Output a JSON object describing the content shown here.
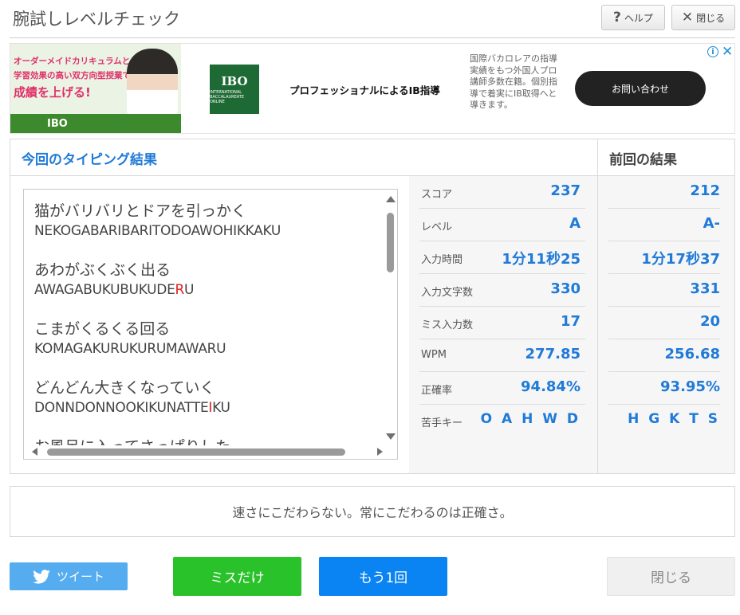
{
  "header": {
    "title": "腕試しレベルチェック",
    "help_label": "ヘルプ",
    "close_label": "閉じる"
  },
  "ad": {
    "image_line1": "オーダーメイドカリキュラムと",
    "image_line2": "学習効果の高い双方向型授業で",
    "image_line3": "成績を上げる!",
    "image_brand": "IBO",
    "logo_text": "IBO",
    "logo_subtext": "INTERNATIONAL BACCALAUREATE ONLINE",
    "headline": "プロフェッショナルによるIB指導",
    "description": "国際バカロレアの指導実績をもつ外国人プロ講師多数在籍。個別指導で着実にIB取得へと導きます。",
    "cta_label": "お問い合わせ"
  },
  "results": {
    "current_title": "今回のタイピング結果",
    "previous_title": "前回の結果",
    "words": [
      {
        "jp": "猫がバリバリとドアを引っかく",
        "romaji_before": "NEKOGABARIBARITODOAWOHIKKAKU",
        "romaji_miss": "",
        "romaji_after": ""
      },
      {
        "jp": "あわがぶくぶく出る",
        "romaji_before": "AWAGABUKUBUKUDE",
        "romaji_miss": "R",
        "romaji_after": "U"
      },
      {
        "jp": "こまがくるくる回る",
        "romaji_before": "KOMAGAKURUKURUMAWARU",
        "romaji_miss": "",
        "romaji_after": ""
      },
      {
        "jp": "どんどん大きくなっていく",
        "romaji_before": "DONNDONNOOKIKUNATTE",
        "romaji_miss": "I",
        "romaji_after": "KU"
      },
      {
        "jp": "お風呂に入ってさっぱりした",
        "romaji_before": "",
        "romaji_miss": "",
        "romaji_after": ""
      }
    ],
    "stats": [
      {
        "label": "スコア",
        "current": "237",
        "previous": "212"
      },
      {
        "label": "レベル",
        "current": "A",
        "previous": "A-"
      },
      {
        "label": "入力時間",
        "current": "1分11秒25",
        "previous": "1分17秒37"
      },
      {
        "label": "入力文字数",
        "current": "330",
        "previous": "331"
      },
      {
        "label": "ミス入力数",
        "current": "17",
        "previous": "20"
      },
      {
        "label": "WPM",
        "current": "277.85",
        "previous": "256.68"
      },
      {
        "label": "正確率",
        "current": "94.84%",
        "previous": "93.95%"
      },
      {
        "label": "苦手キー",
        "current": "O A H W D",
        "previous": "H G K T S"
      }
    ]
  },
  "message": "速さにこだわらない。常にこだわるのは正確さ。",
  "buttons": {
    "tweet": "ツイート",
    "miss_only": "ミスだけ",
    "retry": "もう1回",
    "close": "閉じる"
  },
  "colors": {
    "accent_blue": "#1f7ad8",
    "miss_red": "#e02020",
    "tweet_blue": "#55acee",
    "miss_green": "#2ac22a",
    "retry_blue": "#0a84f2"
  }
}
